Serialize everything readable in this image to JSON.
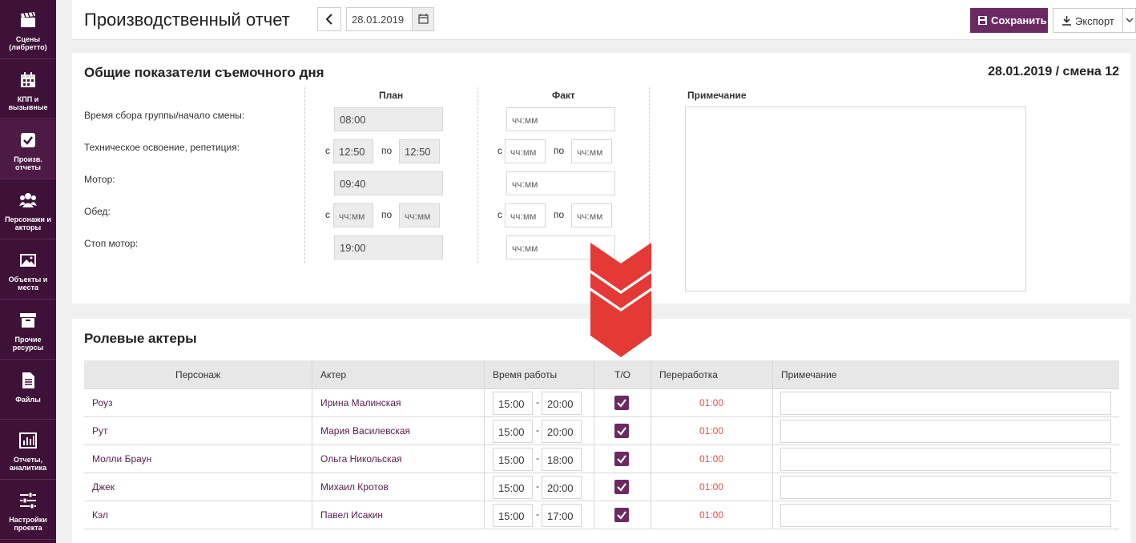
{
  "sidebar": {
    "items": [
      {
        "label": "Сцены\n(либретто)",
        "icon": "clapperboard-icon"
      },
      {
        "label": "КПП и\nвызывные",
        "icon": "calendar-icon"
      },
      {
        "label": "Произв.\nотчеты",
        "icon": "checkbox-icon"
      },
      {
        "label": "Персонажи и\nакторы",
        "icon": "people-icon"
      },
      {
        "label": "Объекты и\nместа",
        "icon": "image-icon"
      },
      {
        "label": "Прочие\nресурсы",
        "icon": "archive-icon"
      },
      {
        "label": "Файлы",
        "icon": "file-icon"
      },
      {
        "label": "Отчеты,\nаналитика",
        "icon": "bar-chart-icon"
      },
      {
        "label": "Настройки\nпроекта",
        "icon": "sliders-icon"
      }
    ]
  },
  "header": {
    "title": "Производственный отчет",
    "date": "28.01.2019",
    "save_label": "Сохранить",
    "export_label": "Экспорт"
  },
  "summary": {
    "title": "Общие показатели съемочного дня",
    "shift_info": "28.01.2019 / смена 12",
    "plan_label": "План",
    "fact_label": "Факт",
    "note_label": "Примечание",
    "from_label": "с",
    "to_label": "по",
    "placeholder": "чч:мм",
    "rows": [
      {
        "label": "Время сбора группы/начало смены:",
        "plan": "08:00",
        "plan_from": "",
        "plan_to": ""
      },
      {
        "label": "Техническое освоение, репетиция:",
        "plan": "",
        "plan_from": "12:50",
        "plan_to": "12:50"
      },
      {
        "label": "Мотор:",
        "plan": "09:40",
        "plan_from": "",
        "plan_to": ""
      },
      {
        "label": "Обед:",
        "plan": "",
        "plan_from": "чч:мм",
        "plan_to": "чч:мм"
      },
      {
        "label": "Стоп мотор:",
        "plan": "19:00",
        "plan_from": "",
        "plan_to": ""
      }
    ]
  },
  "actors": {
    "title": "Ролевые актеры",
    "columns": [
      "Персонаж",
      "Актер",
      "Время работы",
      "Т/О",
      "Переработка",
      "Примечание"
    ],
    "rows": [
      {
        "character": "Роуз",
        "actor": "Ирина Малинская",
        "start": "15:00",
        "end": "20:00",
        "to": true,
        "overtime": "01:00"
      },
      {
        "character": "Рут",
        "actor": "Мария Василевская",
        "start": "15:00",
        "end": "20:00",
        "to": true,
        "overtime": "01:00"
      },
      {
        "character": "Молли Браун",
        "actor": "Ольга Никольская",
        "start": "15:00",
        "end": "18:00",
        "to": true,
        "overtime": "01:00"
      },
      {
        "character": "Джек",
        "actor": "Михаил Кротов",
        "start": "15:00",
        "end": "20:00",
        "to": true,
        "overtime": "01:00"
      },
      {
        "character": "Кэл",
        "actor": "Павел Исакин",
        "start": "15:00",
        "end": "17:00",
        "to": true,
        "overtime": "01:00"
      }
    ]
  },
  "colors": {
    "brand": "#3e1138",
    "accent": "#6b2a62",
    "overtime": "#d9534f",
    "arrow": "#e53935"
  }
}
